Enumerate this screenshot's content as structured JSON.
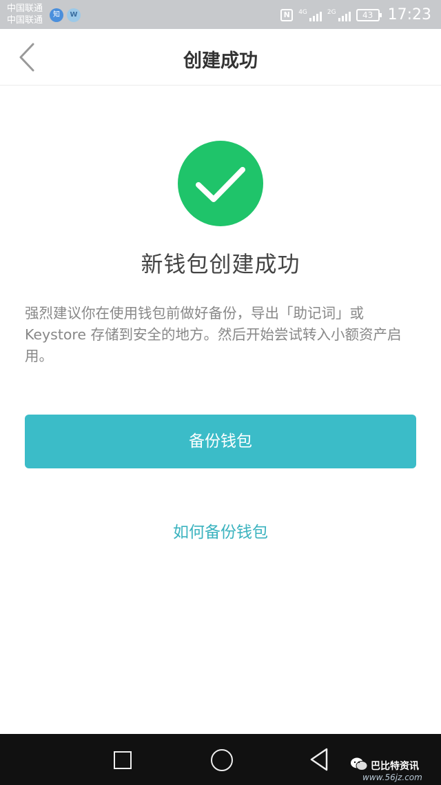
{
  "status_bar": {
    "carrier_1": "中国联通",
    "carrier_2": "中国联通",
    "badge_1": "知",
    "badge_2": "W",
    "nfc": "N",
    "signal_1_type": "4G",
    "signal_2_type": "2G",
    "battery": "43",
    "time": "17:23"
  },
  "nav": {
    "title": "创建成功"
  },
  "main": {
    "success_title": "新钱包创建成功",
    "description": "强烈建议你在使用钱包前做好备份，导出「助记词」或 Keystore 存储到安全的地方。然后开始尝试转入小额资产启用。",
    "backup_button": "备份钱包",
    "how_to_link": "如何备份钱包",
    "accent_color": "#3bbcc8",
    "success_color": "#1fc46a"
  },
  "watermark": {
    "text": "巴比特资讯",
    "url": "www.56jz.com"
  }
}
